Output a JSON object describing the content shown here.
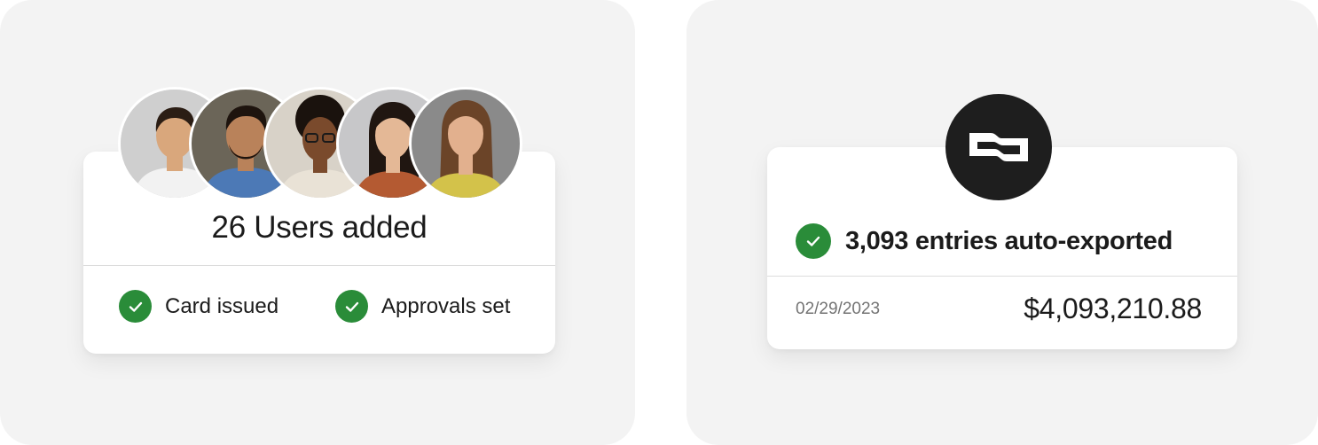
{
  "users_card": {
    "title": "26 Users added",
    "avatars": [
      {
        "icon": "person-avatar-1",
        "skin": "#d9a77c",
        "hair": "#2b1d14",
        "shirt": "#f2f2f2",
        "bg": "#cfcfcf"
      },
      {
        "icon": "person-avatar-2",
        "skin": "#b9825a",
        "hair": "#1e140e",
        "shirt": "#4c79b6",
        "bg": "#6b6558"
      },
      {
        "icon": "person-avatar-3",
        "skin": "#7a4a2c",
        "hair": "#1a120d",
        "shirt": "#e9e2d6",
        "bg": "#d8d2c8"
      },
      {
        "icon": "person-avatar-4",
        "skin": "#e4b896",
        "hair": "#201611",
        "shirt": "#b45a32",
        "bg": "#c7c7c9"
      },
      {
        "icon": "person-avatar-5",
        "skin": "#e2b08e",
        "hair": "#6b4428",
        "shirt": "#d3c24a",
        "bg": "#8a8a8a"
      }
    ],
    "statuses": [
      {
        "label": "Card issued",
        "icon": "check-circle-icon"
      },
      {
        "label": "Approvals set",
        "icon": "check-circle-icon"
      }
    ]
  },
  "export_card": {
    "logo_icon": "brand-logo-icon",
    "title": "3,093 entries auto-exported",
    "date": "02/29/2023",
    "amount": "$4,093,210.88"
  },
  "colors": {
    "panel_bg": "#f3f3f3",
    "success_green": "#2a8c39",
    "logo_bg": "#1e1e1e"
  }
}
